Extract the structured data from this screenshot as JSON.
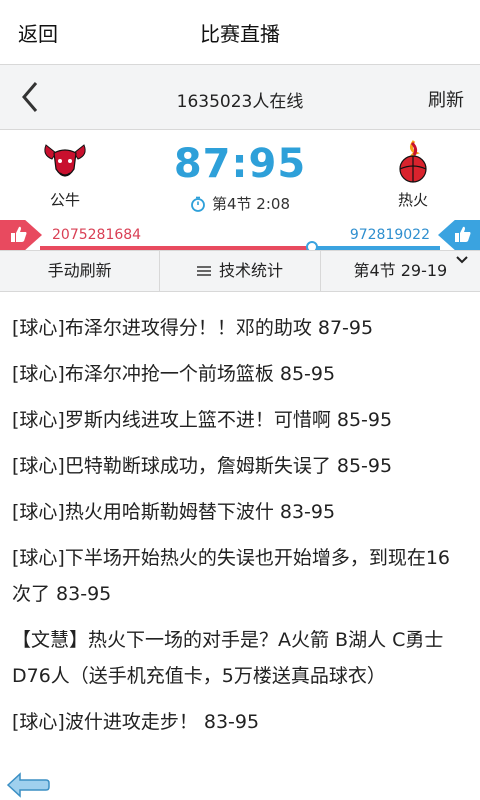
{
  "titlebar": {
    "back_label": "返回",
    "title": "比赛直播"
  },
  "navbar": {
    "online": "1635023人在线",
    "refresh_label": "刷新"
  },
  "match": {
    "home_team": "公牛",
    "away_team": "热火",
    "score": "87:95",
    "period": "第4节 2:08"
  },
  "votes": {
    "left_count": "2075281684",
    "right_count": "972819022",
    "left_fraction": 0.6809
  },
  "tabs": {
    "manual_refresh": "手动刷新",
    "stats": "技术统计",
    "quarter": "第4节 29-19"
  },
  "feed": [
    "[球心]布泽尔进攻得分！！邓的助攻 87-95",
    "[球心]布泽尔冲抢一个前场篮板 85-95",
    "[球心]罗斯内线进攻上篮不进！可惜啊 85-95",
    "[球心]巴特勒断球成功，詹姆斯失误了 85-95",
    "[球心]热火用哈斯勒姆替下波什 83-95",
    "[球心]下半场开始热火的失误也开始增多，到现在16次了 83-95",
    "【文慧】热火下一场的对手是？A火箭 B湖人 C勇士 D76人（送手机充值卡，5万楼送真品球衣）",
    "[球心]波什进攻走步！ 83-95"
  ],
  "colors": {
    "accent": "#2ea0d9",
    "red": "#e84a5f",
    "blue": "#3aa3e0"
  },
  "icons": [
    "chevron-left-icon",
    "bulls-logo",
    "heat-logo",
    "stopwatch-icon",
    "thumbs-up-icon",
    "list-icon",
    "chevron-down-icon",
    "back-arrow-icon"
  ]
}
